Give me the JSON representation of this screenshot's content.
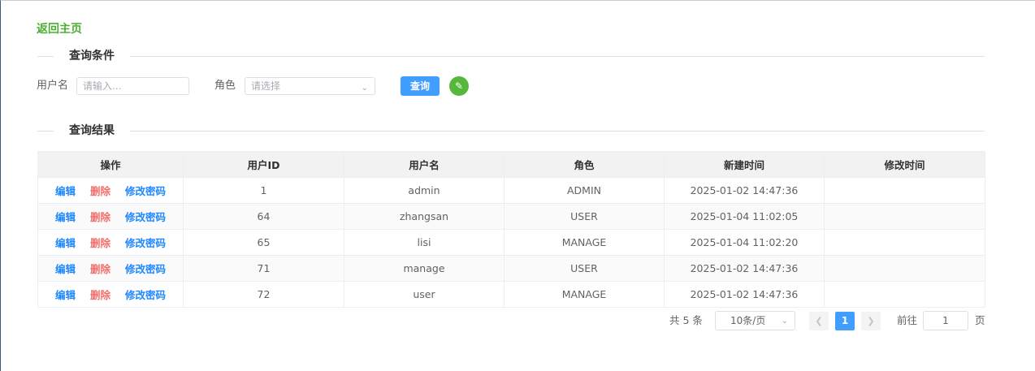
{
  "nav": {
    "back_label": "返回主页"
  },
  "query_section": {
    "title": "查询条件",
    "username_label": "用户名",
    "username_placeholder": "请输入...",
    "role_label": "角色",
    "role_placeholder": "请选择",
    "query_button": "查询"
  },
  "result_section": {
    "title": "查询结果"
  },
  "table": {
    "headers": [
      "操作",
      "用户ID",
      "用户名",
      "角色",
      "新建时间",
      "修改时间"
    ],
    "actions": {
      "edit": "编辑",
      "delete": "删除",
      "change_password": "修改密码"
    },
    "rows": [
      {
        "id": "1",
        "username": "admin",
        "role": "ADMIN",
        "created": "2025-01-02 14:47:36",
        "modified": ""
      },
      {
        "id": "64",
        "username": "zhangsan",
        "role": "USER",
        "created": "2025-01-04 11:02:05",
        "modified": ""
      },
      {
        "id": "65",
        "username": "lisi",
        "role": "MANAGE",
        "created": "2025-01-04 11:02:20",
        "modified": ""
      },
      {
        "id": "71",
        "username": "manage",
        "role": "USER",
        "created": "2025-01-02 14:47:36",
        "modified": ""
      },
      {
        "id": "72",
        "username": "user",
        "role": "MANAGE",
        "created": "2025-01-02 14:47:36",
        "modified": ""
      }
    ]
  },
  "pagination": {
    "total_text": "共 5 条",
    "page_size": "10条/页",
    "current_page": "1",
    "goto_label": "前往",
    "goto_value": "1",
    "page_unit": "页",
    "prev_icon": "chevron-left-icon",
    "next_icon": "chevron-right-icon"
  },
  "colors": {
    "primary": "#409eff",
    "success": "#55b73c",
    "danger": "#f56c6c",
    "back_link": "#4caf32"
  }
}
